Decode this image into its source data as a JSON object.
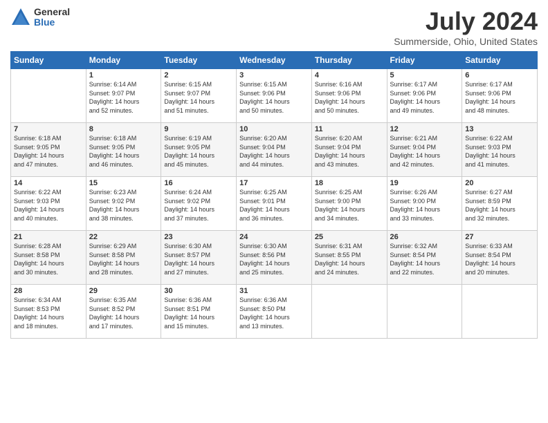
{
  "logo": {
    "general": "General",
    "blue": "Blue"
  },
  "title": "July 2024",
  "location": "Summerside, Ohio, United States",
  "headers": [
    "Sunday",
    "Monday",
    "Tuesday",
    "Wednesday",
    "Thursday",
    "Friday",
    "Saturday"
  ],
  "weeks": [
    [
      {
        "day": "",
        "info": ""
      },
      {
        "day": "1",
        "info": "Sunrise: 6:14 AM\nSunset: 9:07 PM\nDaylight: 14 hours\nand 52 minutes."
      },
      {
        "day": "2",
        "info": "Sunrise: 6:15 AM\nSunset: 9:07 PM\nDaylight: 14 hours\nand 51 minutes."
      },
      {
        "day": "3",
        "info": "Sunrise: 6:15 AM\nSunset: 9:06 PM\nDaylight: 14 hours\nand 50 minutes."
      },
      {
        "day": "4",
        "info": "Sunrise: 6:16 AM\nSunset: 9:06 PM\nDaylight: 14 hours\nand 50 minutes."
      },
      {
        "day": "5",
        "info": "Sunrise: 6:17 AM\nSunset: 9:06 PM\nDaylight: 14 hours\nand 49 minutes."
      },
      {
        "day": "6",
        "info": "Sunrise: 6:17 AM\nSunset: 9:06 PM\nDaylight: 14 hours\nand 48 minutes."
      }
    ],
    [
      {
        "day": "7",
        "info": "Sunrise: 6:18 AM\nSunset: 9:05 PM\nDaylight: 14 hours\nand 47 minutes."
      },
      {
        "day": "8",
        "info": "Sunrise: 6:18 AM\nSunset: 9:05 PM\nDaylight: 14 hours\nand 46 minutes."
      },
      {
        "day": "9",
        "info": "Sunrise: 6:19 AM\nSunset: 9:05 PM\nDaylight: 14 hours\nand 45 minutes."
      },
      {
        "day": "10",
        "info": "Sunrise: 6:20 AM\nSunset: 9:04 PM\nDaylight: 14 hours\nand 44 minutes."
      },
      {
        "day": "11",
        "info": "Sunrise: 6:20 AM\nSunset: 9:04 PM\nDaylight: 14 hours\nand 43 minutes."
      },
      {
        "day": "12",
        "info": "Sunrise: 6:21 AM\nSunset: 9:04 PM\nDaylight: 14 hours\nand 42 minutes."
      },
      {
        "day": "13",
        "info": "Sunrise: 6:22 AM\nSunset: 9:03 PM\nDaylight: 14 hours\nand 41 minutes."
      }
    ],
    [
      {
        "day": "14",
        "info": "Sunrise: 6:22 AM\nSunset: 9:03 PM\nDaylight: 14 hours\nand 40 minutes."
      },
      {
        "day": "15",
        "info": "Sunrise: 6:23 AM\nSunset: 9:02 PM\nDaylight: 14 hours\nand 38 minutes."
      },
      {
        "day": "16",
        "info": "Sunrise: 6:24 AM\nSunset: 9:02 PM\nDaylight: 14 hours\nand 37 minutes."
      },
      {
        "day": "17",
        "info": "Sunrise: 6:25 AM\nSunset: 9:01 PM\nDaylight: 14 hours\nand 36 minutes."
      },
      {
        "day": "18",
        "info": "Sunrise: 6:25 AM\nSunset: 9:00 PM\nDaylight: 14 hours\nand 34 minutes."
      },
      {
        "day": "19",
        "info": "Sunrise: 6:26 AM\nSunset: 9:00 PM\nDaylight: 14 hours\nand 33 minutes."
      },
      {
        "day": "20",
        "info": "Sunrise: 6:27 AM\nSunset: 8:59 PM\nDaylight: 14 hours\nand 32 minutes."
      }
    ],
    [
      {
        "day": "21",
        "info": "Sunrise: 6:28 AM\nSunset: 8:58 PM\nDaylight: 14 hours\nand 30 minutes."
      },
      {
        "day": "22",
        "info": "Sunrise: 6:29 AM\nSunset: 8:58 PM\nDaylight: 14 hours\nand 28 minutes."
      },
      {
        "day": "23",
        "info": "Sunrise: 6:30 AM\nSunset: 8:57 PM\nDaylight: 14 hours\nand 27 minutes."
      },
      {
        "day": "24",
        "info": "Sunrise: 6:30 AM\nSunset: 8:56 PM\nDaylight: 14 hours\nand 25 minutes."
      },
      {
        "day": "25",
        "info": "Sunrise: 6:31 AM\nSunset: 8:55 PM\nDaylight: 14 hours\nand 24 minutes."
      },
      {
        "day": "26",
        "info": "Sunrise: 6:32 AM\nSunset: 8:54 PM\nDaylight: 14 hours\nand 22 minutes."
      },
      {
        "day": "27",
        "info": "Sunrise: 6:33 AM\nSunset: 8:54 PM\nDaylight: 14 hours\nand 20 minutes."
      }
    ],
    [
      {
        "day": "28",
        "info": "Sunrise: 6:34 AM\nSunset: 8:53 PM\nDaylight: 14 hours\nand 18 minutes."
      },
      {
        "day": "29",
        "info": "Sunrise: 6:35 AM\nSunset: 8:52 PM\nDaylight: 14 hours\nand 17 minutes."
      },
      {
        "day": "30",
        "info": "Sunrise: 6:36 AM\nSunset: 8:51 PM\nDaylight: 14 hours\nand 15 minutes."
      },
      {
        "day": "31",
        "info": "Sunrise: 6:36 AM\nSunset: 8:50 PM\nDaylight: 14 hours\nand 13 minutes."
      },
      {
        "day": "",
        "info": ""
      },
      {
        "day": "",
        "info": ""
      },
      {
        "day": "",
        "info": ""
      }
    ]
  ]
}
